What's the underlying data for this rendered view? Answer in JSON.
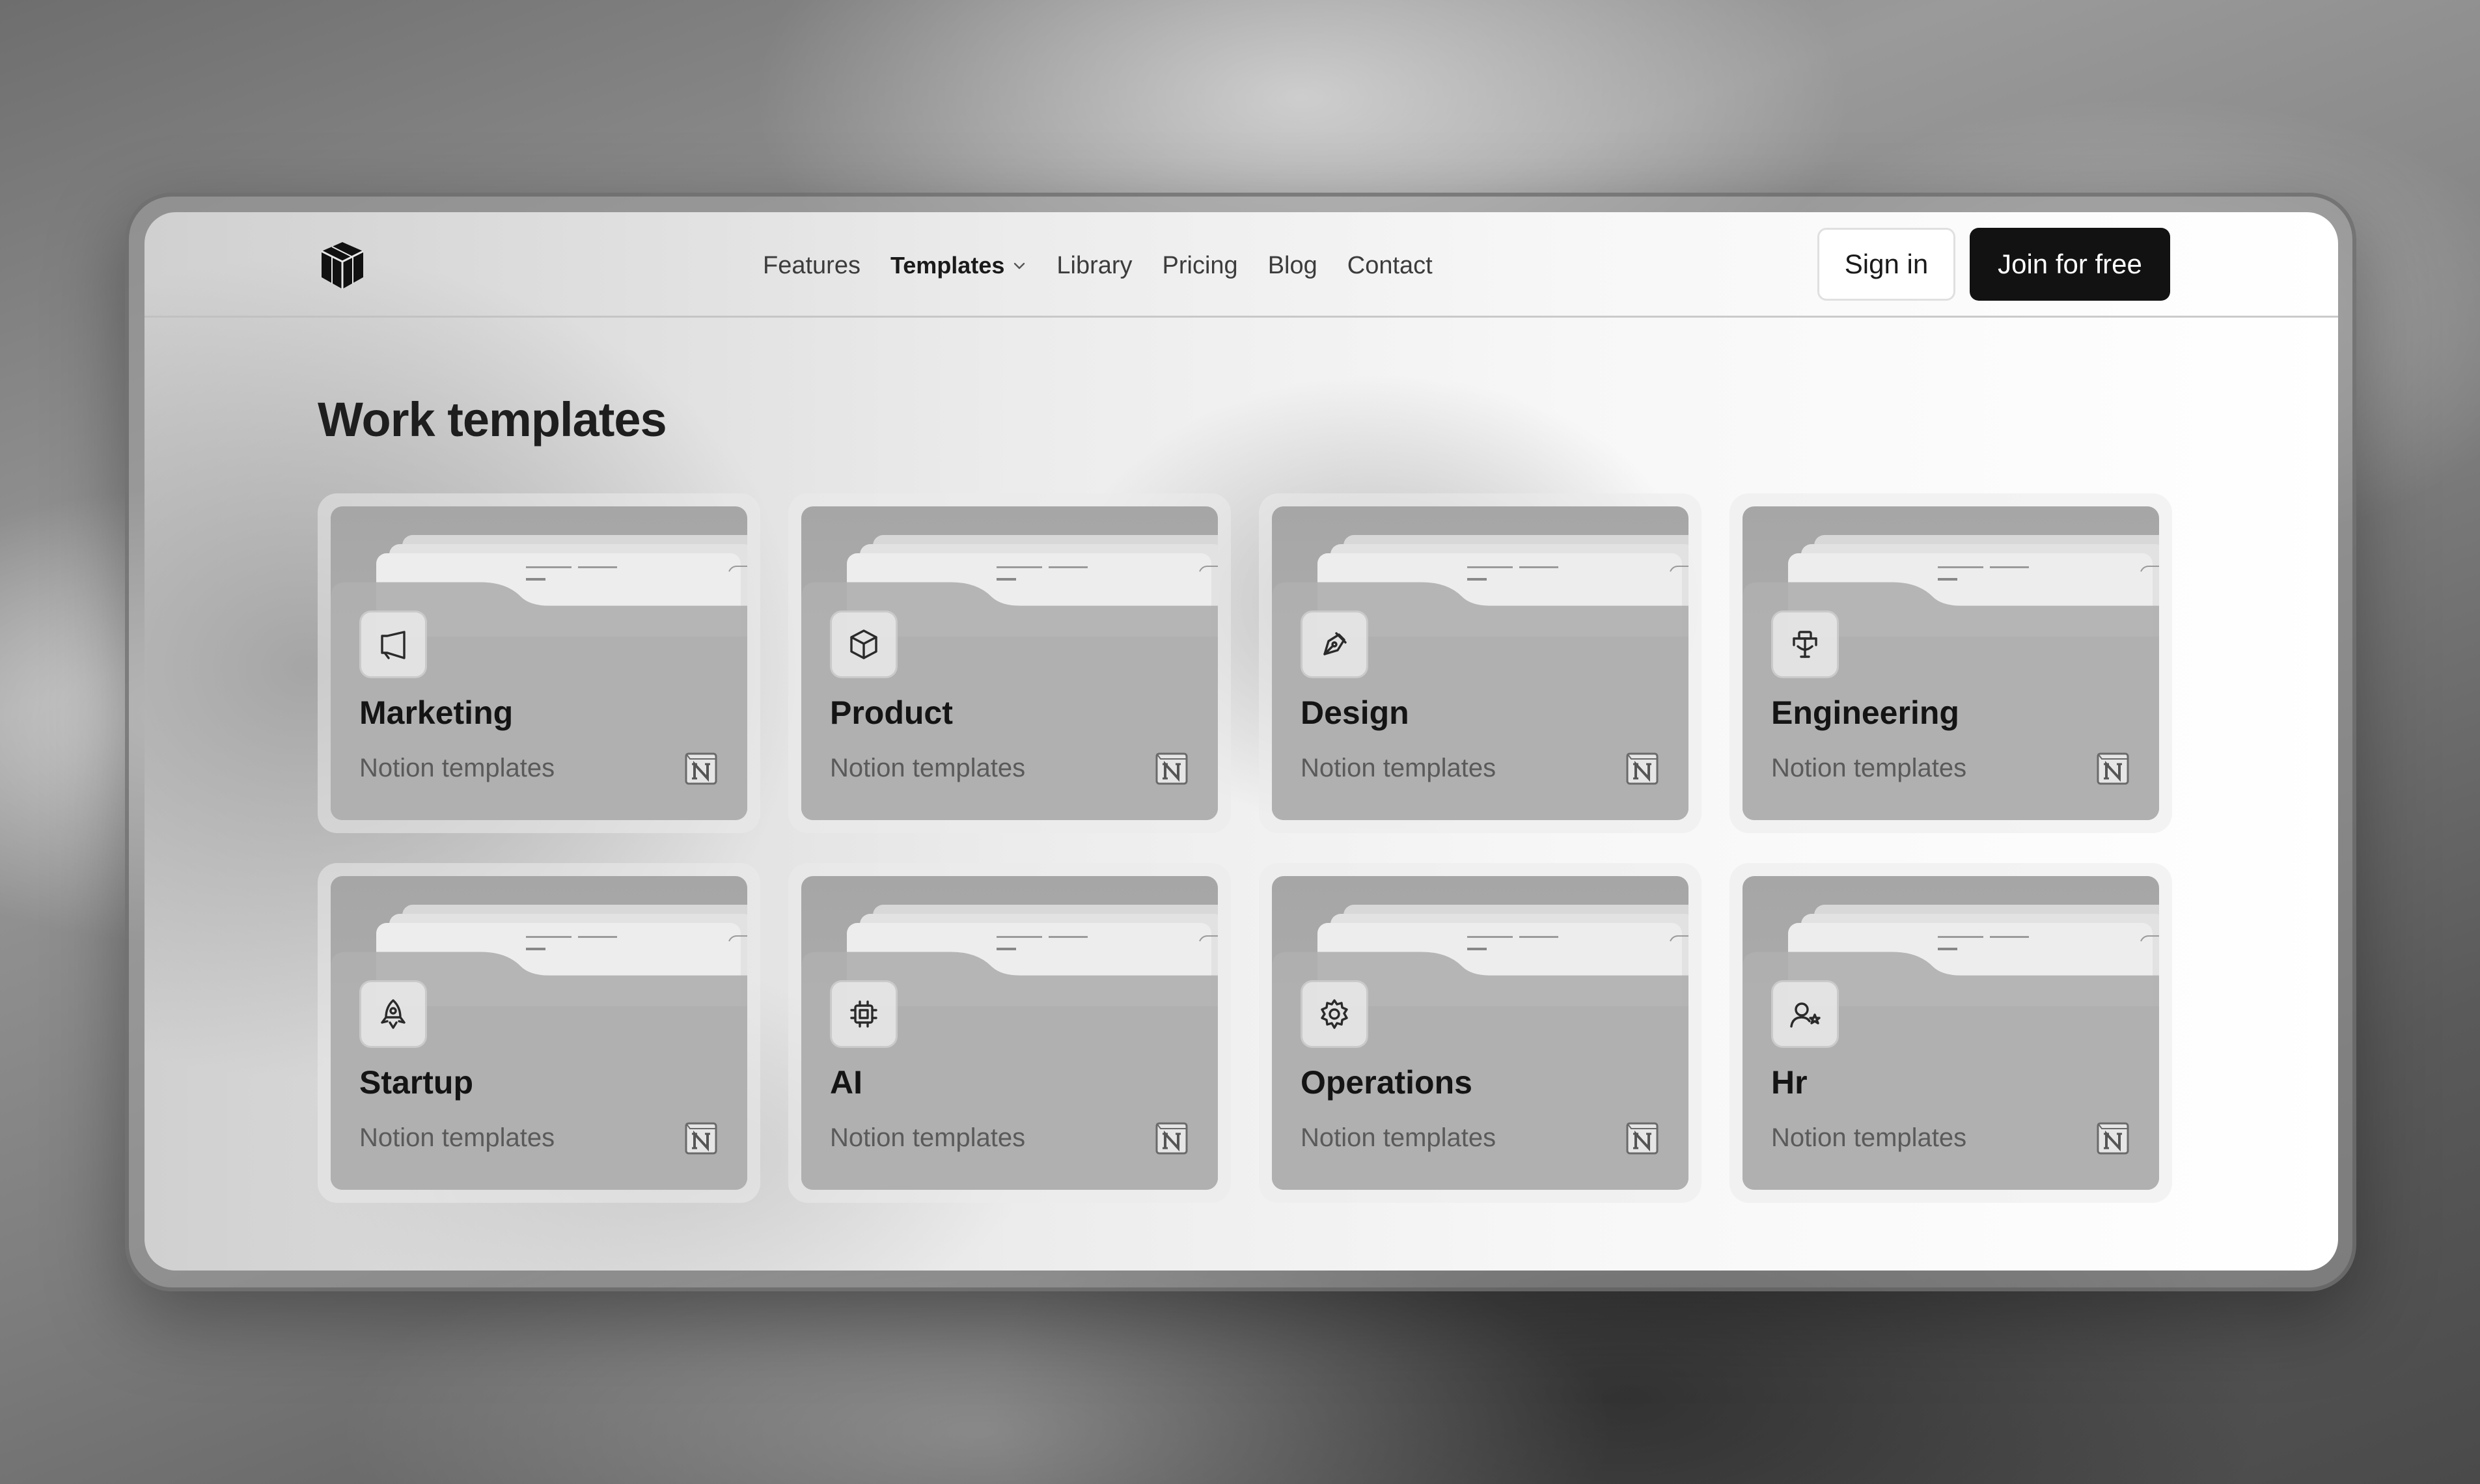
{
  "nav": {
    "links": [
      "Features",
      "Templates",
      "Library",
      "Pricing",
      "Blog",
      "Contact"
    ],
    "active": "Templates",
    "sign_in": "Sign in",
    "join": "Join for free"
  },
  "page": {
    "title": "Work templates"
  },
  "cards": [
    {
      "title": "Marketing",
      "subtitle": "Notion templates",
      "icon": "megaphone-icon"
    },
    {
      "title": "Product",
      "subtitle": "Notion templates",
      "icon": "box-icon"
    },
    {
      "title": "Design",
      "subtitle": "Notion templates",
      "icon": "pen-tool-icon"
    },
    {
      "title": "Engineering",
      "subtitle": "Notion templates",
      "icon": "network-icon"
    },
    {
      "title": "Startup",
      "subtitle": "Notion templates",
      "icon": "rocket-icon"
    },
    {
      "title": "AI",
      "subtitle": "Notion templates",
      "icon": "cpu-icon"
    },
    {
      "title": "Operations",
      "subtitle": "Notion templates",
      "icon": "gear-icon"
    },
    {
      "title": "Hr",
      "subtitle": "Notion templates",
      "icon": "user-star-icon"
    }
  ]
}
